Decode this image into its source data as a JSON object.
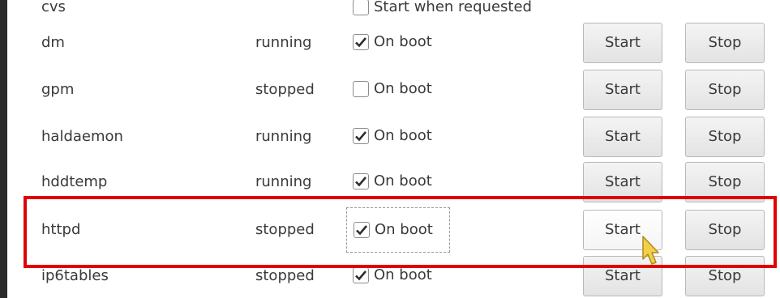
{
  "partial_top_row": {
    "name": "cvs",
    "boot_label": "Start when requested"
  },
  "services": [
    {
      "name": "dm",
      "status": "running",
      "on_boot": true,
      "boot_label": "On boot",
      "start_label": "Start",
      "stop_label": "Stop"
    },
    {
      "name": "gpm",
      "status": "stopped",
      "on_boot": false,
      "boot_label": "On boot",
      "start_label": "Start",
      "stop_label": "Stop"
    },
    {
      "name": "haldaemon",
      "status": "running",
      "on_boot": true,
      "boot_label": "On boot",
      "start_label": "Start",
      "stop_label": "Stop"
    },
    {
      "name": "hddtemp",
      "status": "running",
      "on_boot": true,
      "boot_label": "On boot",
      "start_label": "Start",
      "stop_label": "Stop"
    },
    {
      "name": "httpd",
      "status": "stopped",
      "on_boot": true,
      "boot_label": "On boot",
      "start_label": "Start",
      "stop_label": "Stop"
    },
    {
      "name": "ip6tables",
      "status": "stopped",
      "on_boot": true,
      "boot_label": "On boot",
      "start_label": "Start",
      "stop_label": "Stop"
    }
  ],
  "colors": {
    "highlight": "#e00000",
    "cursor": "#f2d04a"
  }
}
